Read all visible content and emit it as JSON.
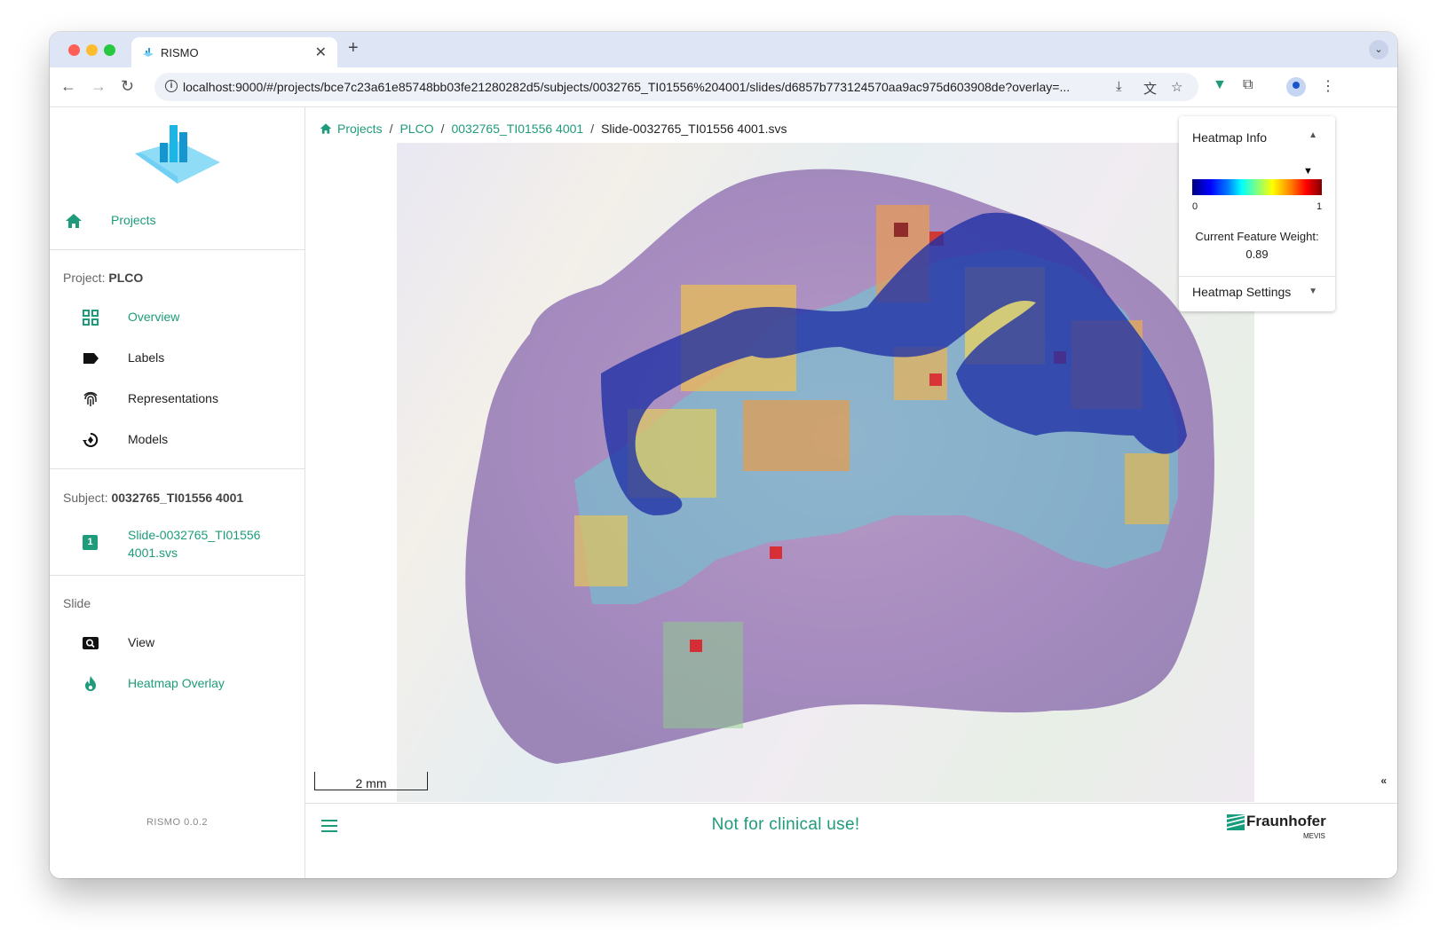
{
  "browser": {
    "tab_title": "RISMO",
    "url": "localhost:9000/#/projects/bce7c23a61e85748bb03fe21280282d5/subjects/0032765_TI01556%204001/slides/d6857b773124570aa9ac975d603908de?overlay=..."
  },
  "sidebar": {
    "home_label": "Projects",
    "project_prefix": "Project:",
    "project_name": "PLCO",
    "project_items": [
      {
        "label": "Overview",
        "icon": "grid-icon",
        "active": true
      },
      {
        "label": "Labels",
        "icon": "label-icon",
        "active": false
      },
      {
        "label": "Representations",
        "icon": "fingerprint-icon",
        "active": false
      },
      {
        "label": "Models",
        "icon": "model-icon",
        "active": false
      }
    ],
    "subject_prefix": "Subject:",
    "subject_name": "0032765_TI01556 4001",
    "slide_item": {
      "badge": "1",
      "label_line1": "Slide-0032765_TI01556",
      "label_line2": "4001.svs"
    },
    "slide_section": "Slide",
    "slide_items": [
      {
        "label": "View",
        "icon": "search-view-icon",
        "active": false
      },
      {
        "label": "Heatmap Overlay",
        "icon": "flame-icon",
        "active": true
      }
    ],
    "version": "RISMO 0.0.2"
  },
  "breadcrumb": {
    "items": [
      "Projects",
      "PLCO",
      "0032765_TI01556 4001"
    ],
    "current": "Slide-0032765_TI01556 4001.svs"
  },
  "viewer": {
    "scale_label": "2 mm",
    "collapse_label": "«"
  },
  "heatmap_panel": {
    "title": "Heatmap Info",
    "cbar_min": "0",
    "cbar_max": "1",
    "feature_label": "Current Feature Weight:",
    "feature_value": "0.89",
    "marker_position": 0.89,
    "settings_title": "Heatmap Settings"
  },
  "footer": {
    "warning": "Not for clinical use!",
    "logo_main": "Fraunhofer",
    "logo_sub": "MEVIS"
  },
  "colors": {
    "accent": "#1e9b7a",
    "tab_strip": "#dee6f5",
    "heat_low": "#00007f",
    "heat_high": "#800000"
  }
}
